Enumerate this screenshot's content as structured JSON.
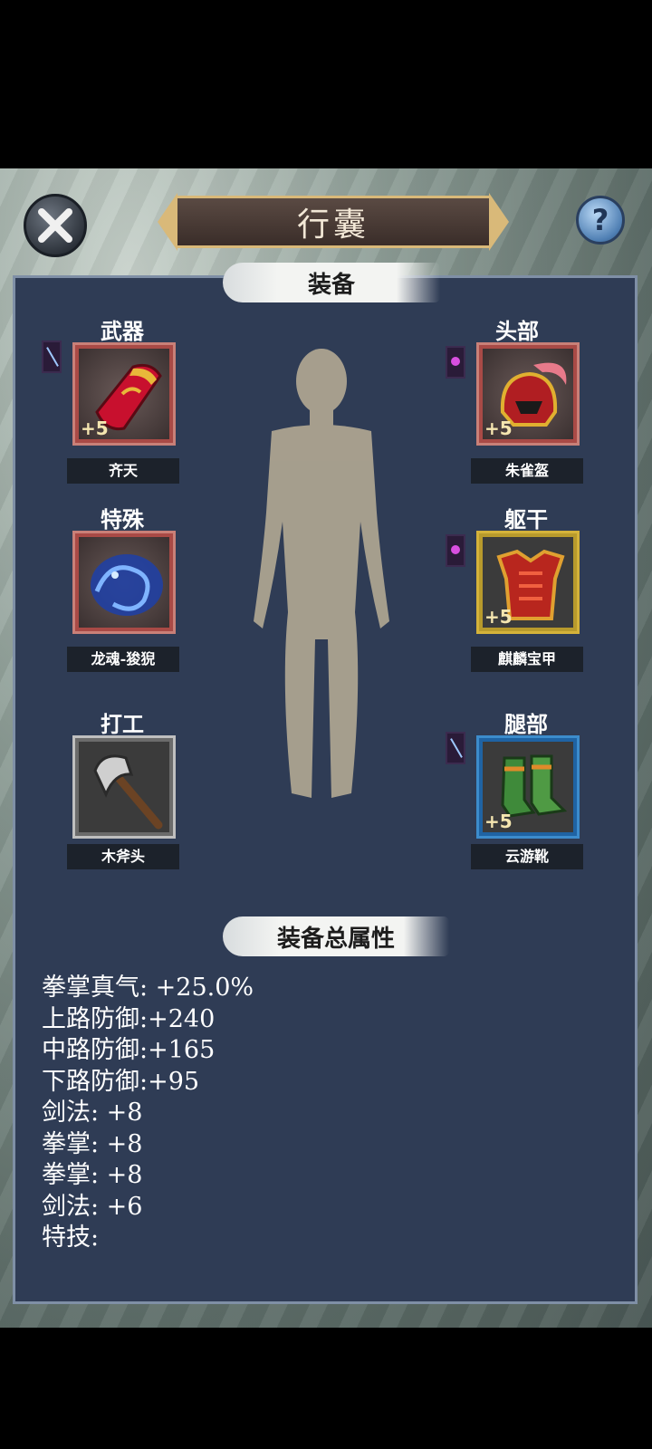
{
  "header": {
    "title": "行囊",
    "close_icon": "close-icon",
    "help_icon": "help-icon"
  },
  "equipment": {
    "section_title": "装备",
    "slots": [
      {
        "label": "武器",
        "name": "齐天",
        "plus": "+5",
        "icon": "red-bracer-icon",
        "gem": "sword"
      },
      {
        "label": "头部",
        "name": "朱雀盔",
        "plus": "+5",
        "icon": "phoenix-helmet-icon",
        "gem": "purple"
      },
      {
        "label": "特殊",
        "name": "龙魂-狻猊",
        "plus": "",
        "icon": "dragon-soul-icon",
        "gem": ""
      },
      {
        "label": "躯干",
        "name": "麒麟宝甲",
        "plus": "+5",
        "icon": "qilin-armor-icon",
        "gem": "purple"
      },
      {
        "label": "打工",
        "name": "木斧头",
        "plus": "",
        "icon": "wood-axe-icon",
        "gem": ""
      },
      {
        "label": "腿部",
        "name": "云游靴",
        "plus": "+5",
        "icon": "green-boots-icon",
        "gem": "sword"
      }
    ]
  },
  "stats": {
    "section_title": "装备总属性",
    "lines": [
      "拳掌真气: +25.0%",
      "上路防御:+240",
      "中路防御:+165",
      "下路防御:+95",
      "剑法: +8",
      "拳掌: +8",
      "拳掌: +8",
      "剑法: +6",
      "特技:"
    ]
  },
  "colors": {
    "panel": "#2f3c55",
    "slot_red": "#c98078",
    "slot_gold": "#d4b23a",
    "slot_blue": "#3c8ccc",
    "slot_gray": "#bfbfbf"
  }
}
